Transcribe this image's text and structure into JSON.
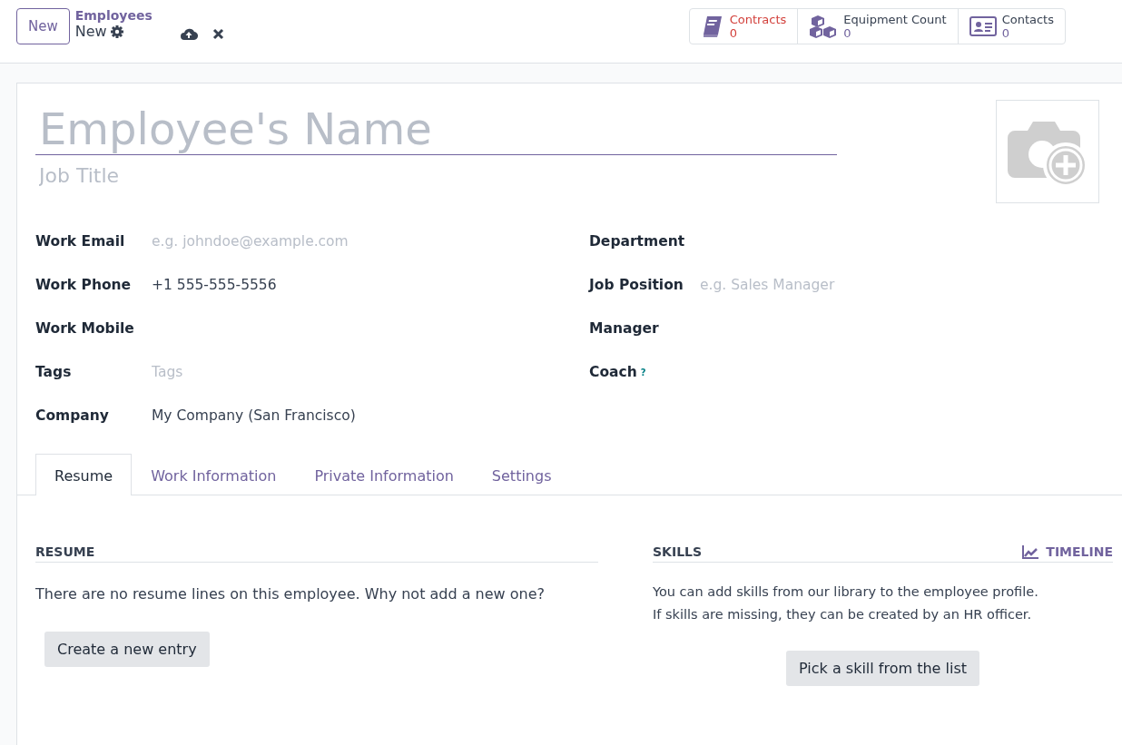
{
  "control_panel": {
    "new_button": "New",
    "breadcrumb": "Employees",
    "record": "New"
  },
  "stat_buttons": [
    {
      "kind": "book",
      "label": "Contracts",
      "value": "0",
      "warning": true
    },
    {
      "kind": "boxes",
      "label": "Equipment Count",
      "value": "0",
      "warning": false
    },
    {
      "kind": "card",
      "label": "Contacts",
      "value": "0",
      "warning": false
    }
  ],
  "form": {
    "name_placeholder": "Employee's Name",
    "job_title_placeholder": "Job Title",
    "left_fields": [
      {
        "label": "Work Email",
        "placeholder": "e.g. johndoe@example.com"
      },
      {
        "label": "Work Phone",
        "value": "+1 555-555-5556"
      },
      {
        "label": "Work Mobile"
      },
      {
        "label": "Tags",
        "placeholder": "Tags"
      },
      {
        "label": "Company",
        "value": "My Company (San Francisco)"
      }
    ],
    "right_fields": [
      {
        "label": "Department"
      },
      {
        "label": "Job Position",
        "placeholder": "e.g. Sales Manager"
      },
      {
        "label": "Manager"
      },
      {
        "label": "Coach",
        "help": "?"
      }
    ]
  },
  "tabs": [
    {
      "label": "Resume",
      "selected": true
    },
    {
      "label": "Work Information",
      "selected": false
    },
    {
      "label": "Private Information",
      "selected": false
    },
    {
      "label": "Settings",
      "selected": false
    }
  ],
  "resume": {
    "title": "RESUME",
    "message": "There are no resume lines on this employee. Why not add a new one?",
    "button": "Create a new entry"
  },
  "skills": {
    "title": "SKILLS",
    "timeline": "TIMELINE",
    "message": "You can add skills from our library to the employee profile.\nIf skills are missing, they can be created by an HR officer.",
    "button": "Pick a skill from the list"
  }
}
